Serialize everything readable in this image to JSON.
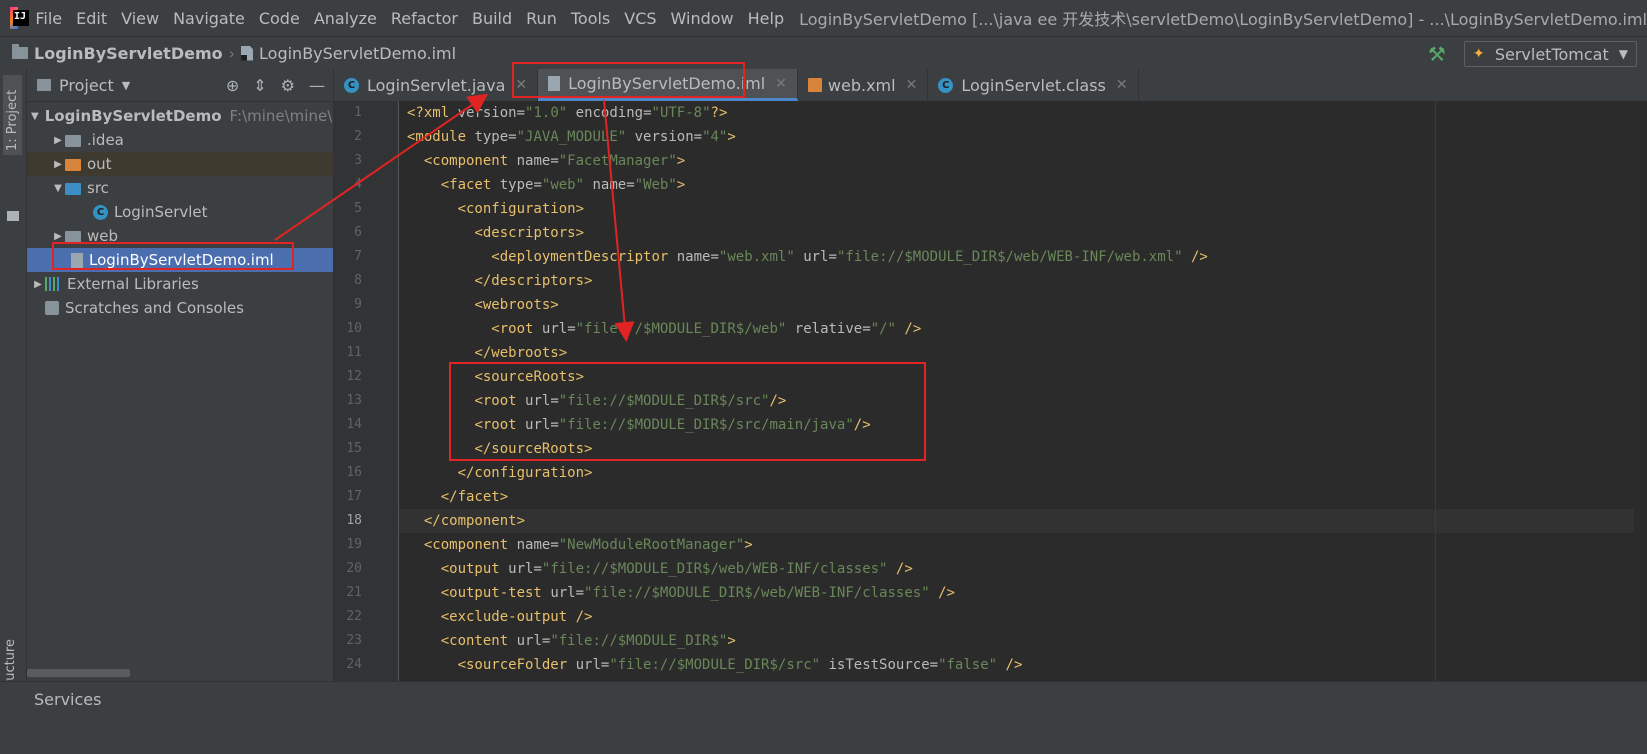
{
  "menubar": {
    "items": [
      {
        "label": "File"
      },
      {
        "label": "Edit"
      },
      {
        "label": "View"
      },
      {
        "label": "Navigate"
      },
      {
        "label": "Code"
      },
      {
        "label": "Analyze"
      },
      {
        "label": "Refactor"
      },
      {
        "label": "Build"
      },
      {
        "label": "Run"
      },
      {
        "label": "Tools"
      },
      {
        "label": "VCS"
      },
      {
        "label": "Window"
      },
      {
        "label": "Help"
      }
    ],
    "window_title": "LoginByServletDemo [...\\java ee 开发技术\\servletDemo\\LoginByServletDemo] - ...\\LoginByServletDemo.iml"
  },
  "navbar": {
    "project": "LoginByServletDemo",
    "file": "LoginByServletDemo.iml",
    "run_config": "ServletTomcat"
  },
  "side_strip": {
    "project_tab": "1: Project",
    "structure_tab": "Z: Structure"
  },
  "project_panel": {
    "title": "Project",
    "tree": [
      {
        "label": "LoginByServletDemo",
        "hint": "F:\\mine\\mine\\L",
        "icon": "folder-icon",
        "level": 0,
        "expanded": true
      },
      {
        "label": ".idea",
        "icon": "folder-icon",
        "level": 1
      },
      {
        "label": "out",
        "icon": "folder-orange-icon",
        "level": 1
      },
      {
        "label": "src",
        "icon": "folder-source-icon",
        "level": 1,
        "expanded": true
      },
      {
        "label": "LoginServlet",
        "icon": "class-icon",
        "level": 2
      },
      {
        "label": "web",
        "icon": "folder-web-icon",
        "level": 1
      },
      {
        "label": "LoginByServletDemo.iml",
        "icon": "iml-file-icon",
        "level": 1,
        "selected": true
      },
      {
        "label": "External Libraries",
        "icon": "libraries-icon",
        "level": 0
      },
      {
        "label": "Scratches and Consoles",
        "icon": "scratches-icon",
        "level": 0
      }
    ]
  },
  "editor_tabs": [
    {
      "label": "LoginServlet.java",
      "icon": "class-icon"
    },
    {
      "label": "LoginByServletDemo.iml",
      "icon": "iml-file-icon",
      "active": true
    },
    {
      "label": "web.xml",
      "icon": "xml-file-icon"
    },
    {
      "label": "LoginServlet.class",
      "icon": "class-icon"
    }
  ],
  "code_lines": [
    "<?xml version=\"1.0\" encoding=\"UTF-8\"?>",
    "<module type=\"JAVA_MODULE\" version=\"4\">",
    "  <component name=\"FacetManager\">",
    "    <facet type=\"web\" name=\"Web\">",
    "      <configuration>",
    "        <descriptors>",
    "          <deploymentDescriptor name=\"web.xml\" url=\"file://$MODULE_DIR$/web/WEB-INF/web.xml\" />",
    "        </descriptors>",
    "        <webroots>",
    "          <root url=\"file://$MODULE_DIR$/web\" relative=\"/\" />",
    "        </webroots>",
    "        <sourceRoots>",
    "        <root url=\"file://$MODULE_DIR$/src\"/>",
    "        <root url=\"file://$MODULE_DIR$/src/main/java\"/>",
    "        </sourceRoots>",
    "      </configuration>",
    "    </facet>",
    "  </component>",
    "  <component name=\"NewModuleRootManager\">",
    "    <output url=\"file://$MODULE_DIR$/web/WEB-INF/classes\" />",
    "    <output-test url=\"file://$MODULE_DIR$/web/WEB-INF/classes\" />",
    "    <exclude-output />",
    "    <content url=\"file://$MODULE_DIR$\">",
    "      <sourceFolder url=\"file://$MODULE_DIR$/src\" isTestSource=\"false\" />"
  ],
  "line_numbers": [
    "1",
    "2",
    "3",
    "4",
    "5",
    "6",
    "7",
    "8",
    "9",
    "10",
    "11",
    "12",
    "13",
    "14",
    "15",
    "16",
    "17",
    "18",
    "19",
    "20",
    "21",
    "22",
    "23",
    "24"
  ],
  "current_line": 18,
  "services": {
    "label": "Services"
  },
  "colors": {
    "background": "#2b2b2b",
    "panel": "#3c3f41",
    "selection": "#4b6eaf",
    "tag": "#e8bf6a",
    "string": "#6a8759",
    "annotation": "#e02424"
  }
}
